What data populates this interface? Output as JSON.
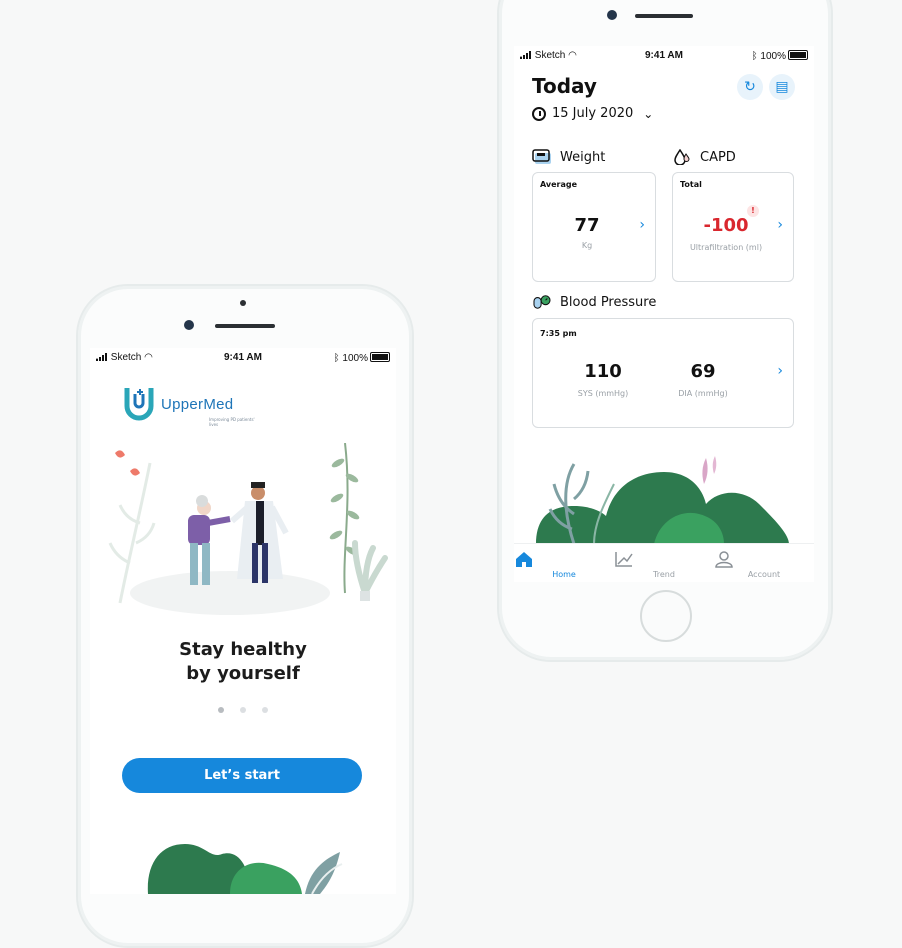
{
  "left_phone": {
    "status": {
      "carrier": "Sketch",
      "time": "9:41 AM",
      "battery": "100%"
    },
    "logo": {
      "name": "UpperMed",
      "tagline": "Improving PD patients' lives"
    },
    "headline_line1": "Stay healthy",
    "headline_line2": "by yourself",
    "pager": {
      "count": 3,
      "active_index": 0
    },
    "cta_label": "Let’s start"
  },
  "right_phone": {
    "status": {
      "carrier": "Sketch",
      "time": "9:41 AM",
      "battery": "100%"
    },
    "title": "Today",
    "date": "15 July 2020",
    "icons": [
      "refresh-icon",
      "document-icon"
    ],
    "weight": {
      "section": "Weight",
      "label": "Average",
      "value": "77",
      "unit": "Kg"
    },
    "capd": {
      "section": "CAPD",
      "label": "Total",
      "value": "-100",
      "unit": "Ultrafiltration (ml)",
      "alert": "!"
    },
    "blood_pressure": {
      "section": "Blood Pressure",
      "time": "7:35 pm",
      "sys_value": "110",
      "sys_unit": "SYS (mmHg)",
      "dia_value": "69",
      "dia_unit": "DIA (mmHg)"
    },
    "tabs": [
      {
        "label": "Home",
        "icon": "home-icon",
        "active": true
      },
      {
        "label": "Trend",
        "icon": "trend-icon",
        "active": false
      },
      {
        "label": "Account",
        "icon": "account-icon",
        "active": false
      }
    ]
  },
  "colors": {
    "primary": "#1688dc",
    "alert_red": "#d9272e",
    "foliage_dark": "#1f7a4d",
    "foliage_light": "#2e9a5a"
  }
}
